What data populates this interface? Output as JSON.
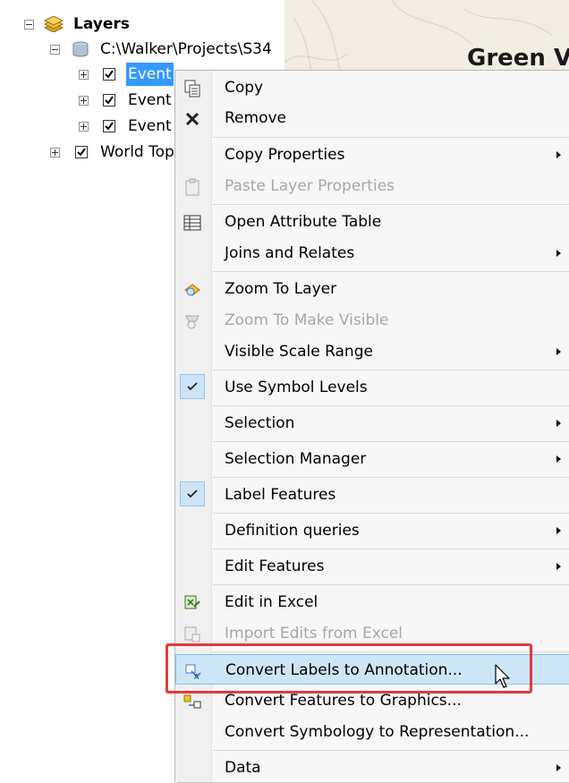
{
  "toc": {
    "layers_label": "Layers",
    "path_label": "C:\\Walker\\Projects\\S34",
    "event1": "Event",
    "event2": "Event",
    "event3": "Event",
    "world_label": "World Top"
  },
  "map": {
    "title": "Green V"
  },
  "menu": {
    "copy": "Copy",
    "remove": "Remove",
    "copy_properties": "Copy Properties",
    "paste_layer_properties": "Paste Layer Properties",
    "open_attribute_table": "Open Attribute Table",
    "joins_and_relates": "Joins and Relates",
    "zoom_to_layer": "Zoom To Layer",
    "zoom_to_make_visible": "Zoom To Make Visible",
    "visible_scale_range": "Visible Scale Range",
    "use_symbol_levels": "Use Symbol Levels",
    "selection": "Selection",
    "selection_manager": "Selection Manager",
    "label_features": "Label Features",
    "definition_queries": "Definition queries",
    "edit_features": "Edit Features",
    "edit_in_excel": "Edit in Excel",
    "import_edits_from_excel": "Import Edits from Excel",
    "convert_labels_to_annotation": "Convert Labels to Annotation...",
    "convert_features_to_graphics": "Convert Features to Graphics...",
    "convert_symbology_to_representation": "Convert Symbology to Representation...",
    "data": "Data"
  },
  "colors": {
    "highlight": "#3399ff",
    "callout_box": "#e4393c",
    "menu_hover": "#cde6f7"
  }
}
